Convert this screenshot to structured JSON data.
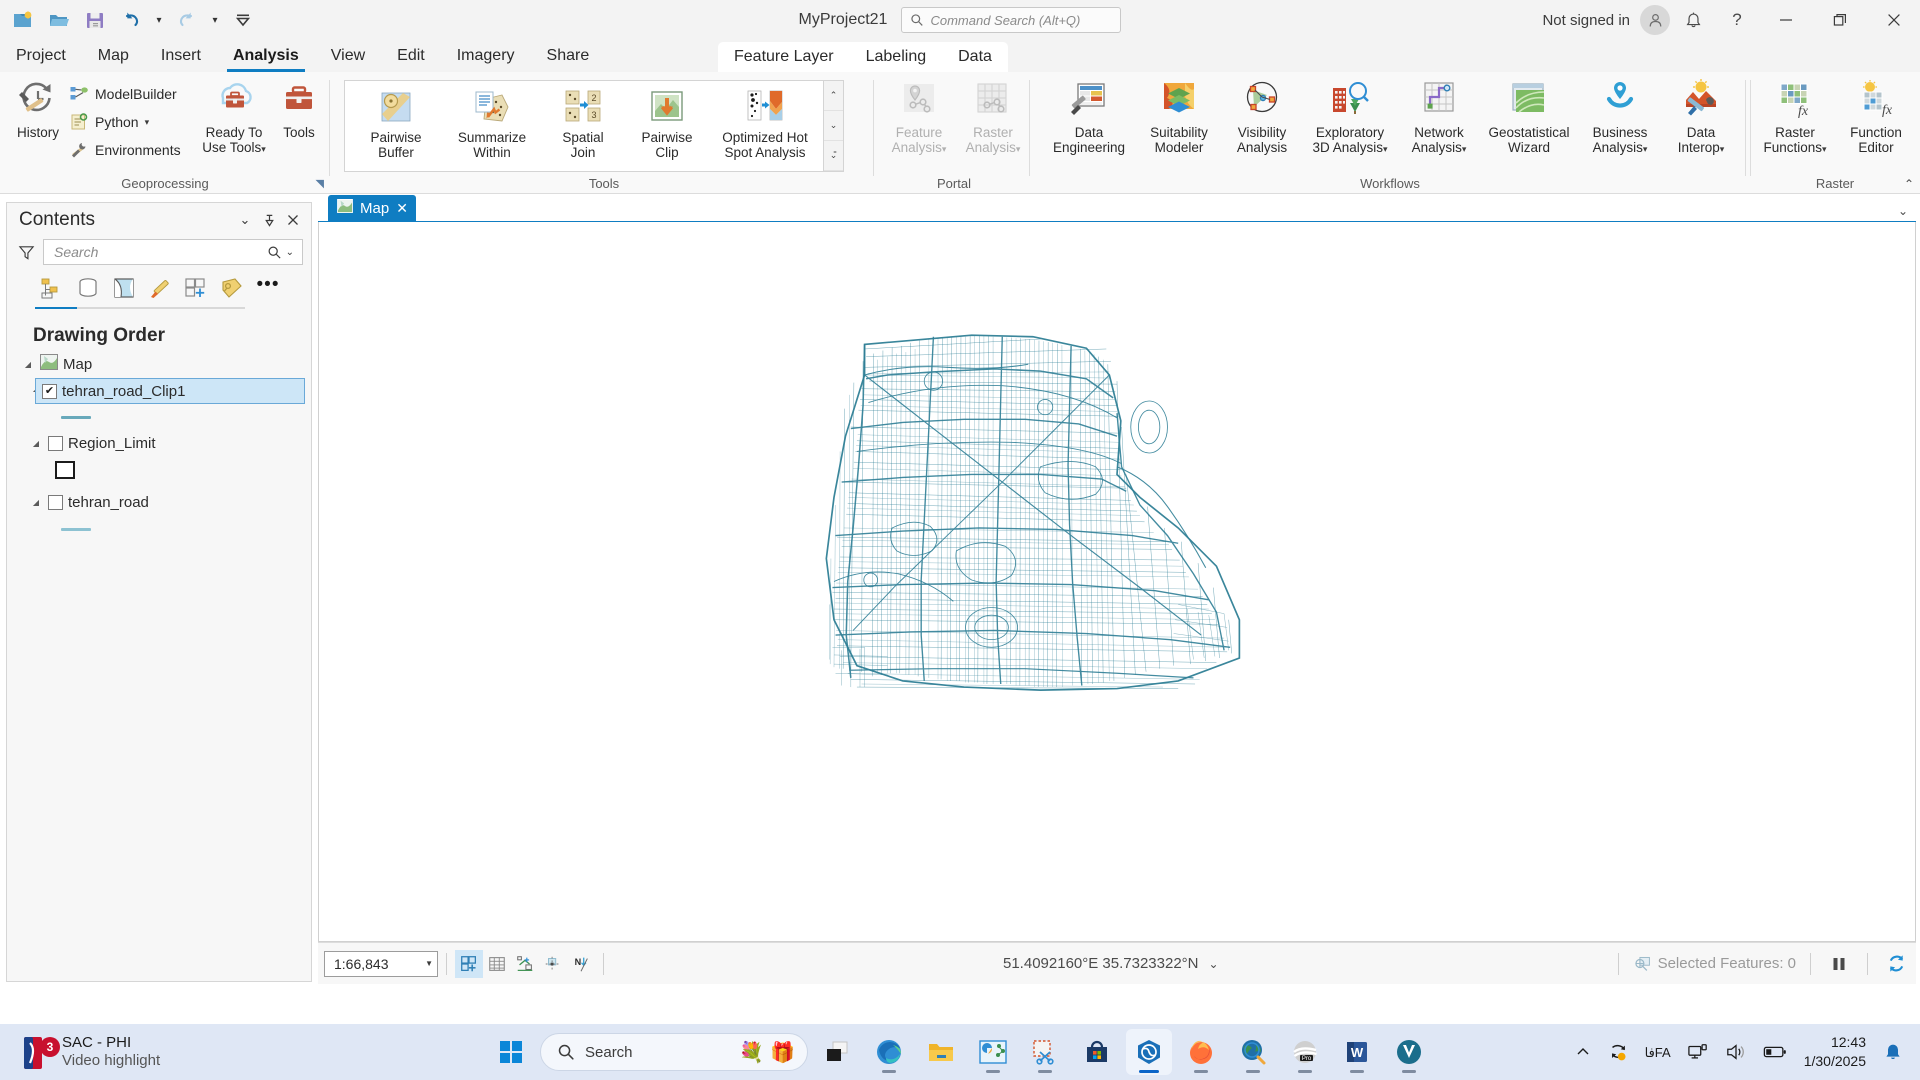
{
  "titlebar": {
    "quick_access": [
      {
        "name": "new-project-icon",
        "label": "New Project"
      },
      {
        "name": "open-project-icon",
        "label": "Open Project"
      },
      {
        "name": "save-project-icon",
        "label": "Save Project"
      },
      {
        "name": "undo-icon",
        "label": "Undo"
      },
      {
        "name": "undo-dropdown-icon",
        "label": "Undo options"
      },
      {
        "name": "redo-icon",
        "label": "Redo"
      },
      {
        "name": "redo-dropdown-icon",
        "label": "Redo options"
      },
      {
        "name": "customize-quick-access-icon",
        "label": "Customize Quick Access Toolbar"
      }
    ],
    "project_title": "MyProject21",
    "command_search_placeholder": "Command Search (Alt+Q)",
    "sign_in_status": "Not signed in",
    "notifications_label": "Notifications",
    "help_label": "?",
    "minimize_label": "Minimize",
    "restore_label": "Restore",
    "close_label": "Close"
  },
  "ribbon_tabs": {
    "main": [
      {
        "label": "Project",
        "active": false
      },
      {
        "label": "Map",
        "active": false
      },
      {
        "label": "Insert",
        "active": false
      },
      {
        "label": "Analysis",
        "active": true
      },
      {
        "label": "View",
        "active": false
      },
      {
        "label": "Edit",
        "active": false
      },
      {
        "label": "Imagery",
        "active": false
      },
      {
        "label": "Share",
        "active": false
      }
    ],
    "contextual": [
      {
        "label": "Feature Layer"
      },
      {
        "label": "Labeling"
      },
      {
        "label": "Data"
      }
    ]
  },
  "ribbon": {
    "groups": [
      {
        "name": "geoprocessing",
        "label": "Geoprocessing"
      },
      {
        "name": "tools",
        "label": "Tools"
      },
      {
        "name": "portal",
        "label": "Portal"
      },
      {
        "name": "workflows",
        "label": "Workflows"
      },
      {
        "name": "raster",
        "label": "Raster"
      }
    ],
    "geoprocessing": {
      "history_label": "History",
      "modelbuilder_label": "ModelBuilder",
      "python_label": "Python",
      "environments_label": "Environments",
      "ready_to_use_tools_label": "Ready To\nUse Tools",
      "ready_to_use_tools_line1": "Ready To",
      "ready_to_use_tools_line2": "Use Tools",
      "tools_label": "Tools"
    },
    "tools_gallery": [
      {
        "line1": "Pairwise",
        "line2": "Buffer",
        "icon": "pairwise-buffer-icon"
      },
      {
        "line1": "Summarize",
        "line2": "Within",
        "icon": "summarize-within-icon"
      },
      {
        "line1": "Spatial",
        "line2": "Join",
        "icon": "spatial-join-icon"
      },
      {
        "line1": "Pairwise",
        "line2": "Clip",
        "icon": "pairwise-clip-icon"
      },
      {
        "line1": "Optimized Hot",
        "line2": "Spot Analysis",
        "icon": "optimized-hot-spot-analysis-icon"
      }
    ],
    "portal": [
      {
        "line1": "Feature",
        "line2": "Analysis",
        "dropdown": true,
        "disabled": true,
        "icon": "feature-analysis-icon"
      },
      {
        "line1": "Raster",
        "line2": "Analysis",
        "dropdown": true,
        "disabled": true,
        "icon": "raster-analysis-icon"
      }
    ],
    "workflows": [
      {
        "line1": "Data",
        "line2": "Engineering",
        "dropdown": false,
        "icon": "data-engineering-icon"
      },
      {
        "line1": "Suitability",
        "line2": "Modeler",
        "dropdown": false,
        "icon": "suitability-modeler-icon"
      },
      {
        "line1": "Visibility",
        "line2": "Analysis",
        "dropdown": false,
        "icon": "visibility-analysis-icon"
      },
      {
        "line1": "Exploratory",
        "line2": "3D Analysis",
        "dropdown": true,
        "icon": "exploratory-3d-analysis-icon"
      },
      {
        "line1": "Network",
        "line2": "Analysis",
        "dropdown": true,
        "icon": "network-analysis-icon"
      },
      {
        "line1": "Geostatistical",
        "line2": "Wizard",
        "dropdown": false,
        "icon": "geostatistical-wizard-icon"
      },
      {
        "line1": "Business",
        "line2": "Analysis",
        "dropdown": true,
        "icon": "business-analysis-icon"
      },
      {
        "line1": "Data",
        "line2": "Interop",
        "dropdown": true,
        "icon": "data-interop-icon"
      }
    ],
    "raster": [
      {
        "line1": "Raster",
        "line2": "Functions",
        "dropdown": true,
        "icon": "raster-functions-icon"
      },
      {
        "line1": "Function",
        "line2": "Editor",
        "dropdown": false,
        "icon": "function-editor-icon"
      }
    ]
  },
  "contents_pane": {
    "title": "Contents",
    "search_placeholder": "Search",
    "tools": [
      {
        "name": "list-by-drawing-order-icon",
        "active": true
      },
      {
        "name": "list-by-data-source-icon",
        "active": false
      },
      {
        "name": "list-by-selection-icon",
        "active": false
      },
      {
        "name": "list-by-editing-icon",
        "active": false
      },
      {
        "name": "list-by-snapping-icon",
        "active": false
      },
      {
        "name": "list-by-labeling-icon",
        "active": false
      }
    ],
    "more_label": "•••",
    "section_title": "Drawing Order",
    "tree": [
      {
        "name": "map",
        "label": "Map",
        "kind": "map",
        "expanded": true,
        "checkbox": null
      },
      {
        "name": "tehran_road_Clip1",
        "label": "tehran_road_Clip1",
        "kind": "layer",
        "expanded": true,
        "checked": true,
        "selected": true,
        "symbol": "line",
        "symbol_color": "#68a9bb"
      },
      {
        "name": "Region_Limit",
        "label": "Region_Limit",
        "kind": "layer",
        "expanded": true,
        "checked": false,
        "selected": false,
        "symbol": "polygon",
        "symbol_color": "#1b1b1b"
      },
      {
        "name": "tehran_road",
        "label": "tehran_road",
        "kind": "layer",
        "expanded": true,
        "checked": false,
        "selected": false,
        "symbol": "line",
        "symbol_color": "#8dc2d2"
      }
    ]
  },
  "map_view": {
    "tab_label": "Map",
    "tab_close_label": "✕",
    "layer_color": "#2f7f96"
  },
  "map_status": {
    "scale": "1:66,843",
    "buttons": [
      {
        "name": "map-view-button",
        "active": true
      },
      {
        "name": "table-view-button",
        "active": false
      },
      {
        "name": "edit-vertices-button",
        "active": false
      },
      {
        "name": "snapping-button",
        "active": false
      },
      {
        "name": "north-arrow-button",
        "active": false
      }
    ],
    "coordinates": "51.4092160°E 35.7323322°N",
    "selected_features": "Selected Features: 0",
    "pause_label": "Pause drawing",
    "refresh_label": "Refresh"
  },
  "taskbar": {
    "notification": {
      "title": "SAC - PHI",
      "subtitle": "Video highlight",
      "badge_count": "3"
    },
    "search_label": "Search",
    "apps": [
      {
        "name": "windows-start-icon",
        "active": false
      },
      {
        "name": "search-pill",
        "active": false
      },
      {
        "name": "task-view-icon",
        "active": false
      },
      {
        "name": "microsoft-edge-icon",
        "active": false
      },
      {
        "name": "file-explorer-icon",
        "active": false
      },
      {
        "name": "powerpoint-icon",
        "active": false
      },
      {
        "name": "snipping-tool-icon",
        "active": false
      },
      {
        "name": "microsoft-store-icon",
        "active": false
      },
      {
        "name": "arcgis-pro-icon",
        "active": true
      },
      {
        "name": "firefox-icon",
        "active": false
      },
      {
        "name": "google-earth-icon",
        "active": false
      },
      {
        "name": "arcmap-pro-icon",
        "active": false
      },
      {
        "name": "microsoft-word-icon",
        "active": false
      },
      {
        "name": "viber-icon",
        "active": false
      }
    ],
    "tray": {
      "expand_label": "Show hidden icons",
      "ime_line1": "فا",
      "ime_line2": "FA",
      "time": "12:43",
      "date": "1/30/2025"
    }
  }
}
